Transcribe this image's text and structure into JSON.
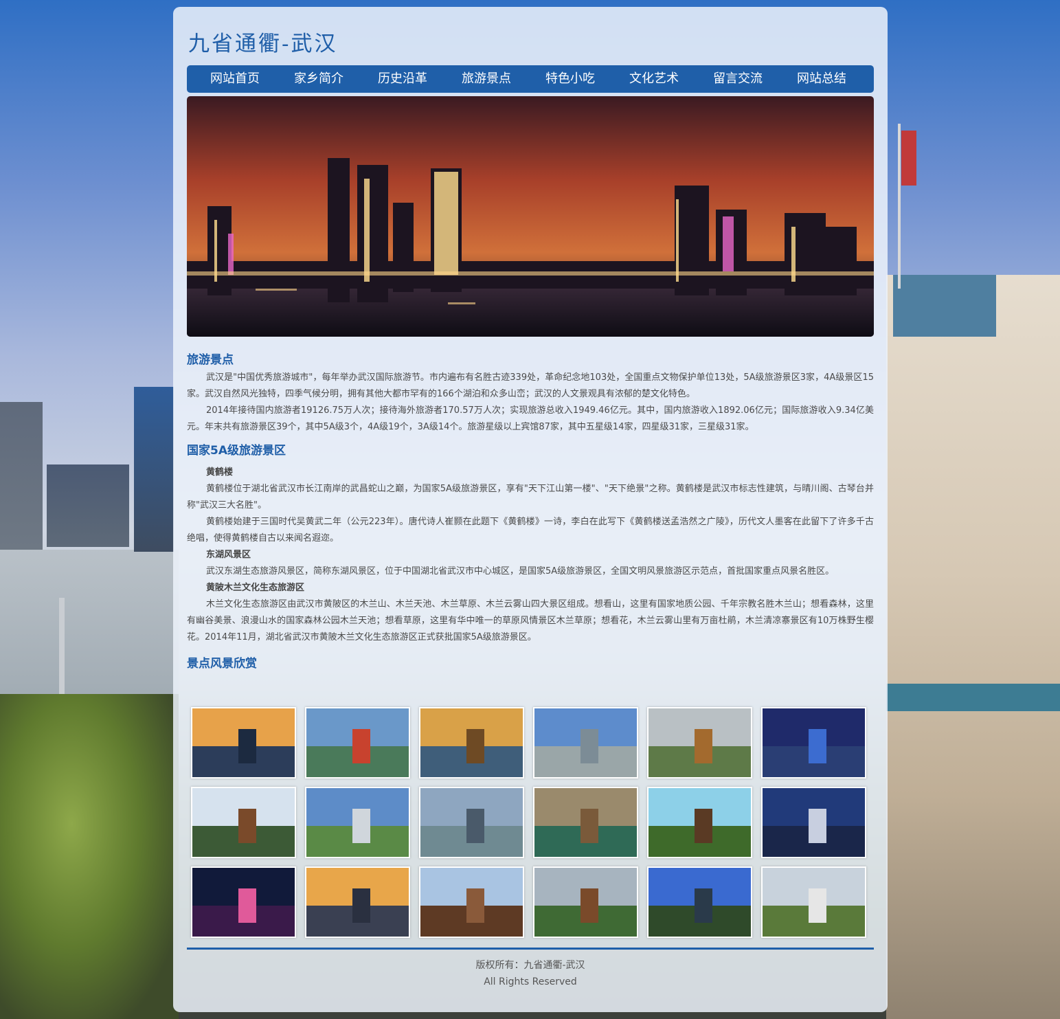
{
  "site": {
    "title": "九省通衢-武汉"
  },
  "nav": [
    "网站首页",
    "家乡简介",
    "历史沿革",
    "旅游景点",
    "特色小吃",
    "文化艺术",
    "留言交流",
    "网站总结"
  ],
  "sections": {
    "tourism": {
      "title": "旅游景点",
      "paragraphs": [
        "武汉是\"中国优秀旅游城市\"，每年举办武汉国际旅游节。市内遍布有名胜古迹339处，革命纪念地103处，全国重点文物保护单位13处，5A级旅游景区3家，4A级景区15家。武汉自然风光独特，四季气候分明，拥有其他大都市罕有的166个湖泊和众多山峦；武汉的人文景观具有浓郁的楚文化特色。",
        "2014年接待国内旅游者19126.75万人次；接待海外旅游者170.57万人次；实现旅游总收入1949.46亿元。其中，国内旅游收入1892.06亿元；国际旅游收入9.34亿美元。年末共有旅游景区39个，其中5A级3个，4A级19个，3A级14个。旅游星级以上宾馆87家，其中五星级14家，四星级31家，三星级31家。"
      ]
    },
    "national5a": {
      "title": "国家5A级旅游景区",
      "huanghelou": {
        "name": "黄鹤楼",
        "p1": "黄鹤楼位于湖北省武汉市长江南岸的武昌蛇山之巅，为国家5A级旅游景区，享有\"天下江山第一楼\"、\"天下绝景\"之称。黄鹤楼是武汉市标志性建筑，与晴川阁、古琴台并称\"武汉三大名胜\"。",
        "p2": "黄鹤楼始建于三国时代吴黄武二年（公元223年）。唐代诗人崔颢在此题下《黄鹤楼》一诗，李白在此写下《黄鹤楼送孟浩然之广陵》，历代文人墨客在此留下了许多千古绝唱，使得黄鹤楼自古以来闻名遐迩。"
      },
      "donghu": {
        "name": "东湖风景区",
        "p1": "武汉东湖生态旅游风景区，简称东湖风景区，位于中国湖北省武汉市中心城区，是国家5A级旅游景区，全国文明风景旅游区示范点，首批国家重点风景名胜区。"
      },
      "mulan": {
        "name": "黄陂木兰文化生态旅游区",
        "p1": "木兰文化生态旅游区由武汉市黄陂区的木兰山、木兰天池、木兰草原、木兰云雾山四大景区组成。想看山，这里有国家地质公园、千年宗教名胜木兰山；想看森林，这里有幽谷美景、浪漫山水的国家森林公园木兰天池；想看草原，这里有华中唯一的草原风情景区木兰草原；想看花，木兰云雾山里有万亩杜鹃，木兰清凉寨景区有10万株野生樱花。2014年11月，湖北省武汉市黄陂木兰文化生态旅游区正式获批国家5A级旅游景区。"
      }
    },
    "gallery": {
      "title": "景点风景欣赏",
      "thumbs": [
        {
          "sky": "#e7a24a",
          "land": "#2c3d5a",
          "obj": "#1c2a40"
        },
        {
          "sky": "#6a98c9",
          "land": "#4a7a5a",
          "obj": "#c8422e"
        },
        {
          "sky": "#d9a148",
          "land": "#3f5e7a",
          "obj": "#6e4a24"
        },
        {
          "sky": "#5d8ccc",
          "land": "#9aa6a8",
          "obj": "#7c8c96"
        },
        {
          "sky": "#b9c0c4",
          "land": "#5e7a48",
          "obj": "#a36a2e"
        },
        {
          "sky": "#1f2a6a",
          "land": "#2a3e74",
          "obj": "#3c6cd0"
        },
        {
          "sky": "#d6e2ee",
          "land": "#3c5a36",
          "obj": "#7a4a2a"
        },
        {
          "sky": "#5d8cc8",
          "land": "#5a8a46",
          "obj": "#d0d6dc"
        },
        {
          "sky": "#8ea6c0",
          "land": "#6f8a92",
          "obj": "#4a5a6a"
        },
        {
          "sky": "#9a8a6c",
          "land": "#2f6a56",
          "obj": "#7a5a3a"
        },
        {
          "sky": "#8dd0e8",
          "land": "#3e6a2a",
          "obj": "#5a3a24"
        },
        {
          "sky": "#213a7a",
          "land": "#1a264a",
          "obj": "#c8cfe0"
        },
        {
          "sky": "#111a3a",
          "land": "#3a1a4a",
          "obj": "#e05a9a"
        },
        {
          "sky": "#e8a64a",
          "land": "#3a4052",
          "obj": "#2a3040"
        },
        {
          "sky": "#a9c4e2",
          "land": "#5e3a24",
          "obj": "#8a5a3a"
        },
        {
          "sky": "#a7b4bf",
          "land": "#3f6a34",
          "obj": "#7a4a2a"
        },
        {
          "sky": "#3a6ad0",
          "land": "#2f4a2a",
          "obj": "#2a3a4a"
        },
        {
          "sky": "#c8d2dc",
          "land": "#5a7a3a",
          "obj": "#e6e6e6"
        }
      ]
    }
  },
  "footer": {
    "line1": "版权所有：九省通衢-武汉",
    "line2": "All Rights Reserved"
  }
}
